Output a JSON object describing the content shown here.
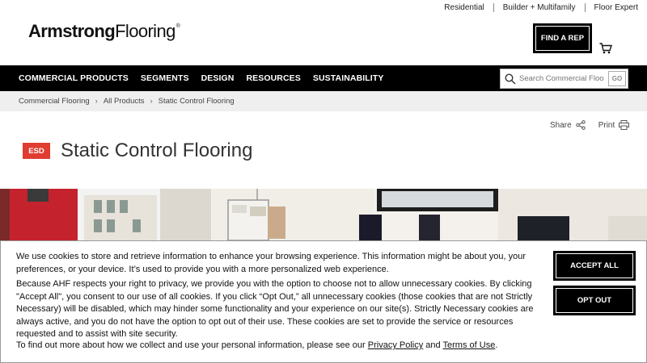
{
  "utility_nav": [
    "Residential",
    "Builder + Multifamily",
    "Floor Expert"
  ],
  "logo": {
    "bold": "Armstrong",
    "light": "Flooring",
    "mark": "®"
  },
  "header": {
    "find_rep": "FIND A REP",
    "cart_icon": "cart-icon"
  },
  "nav": {
    "items": [
      "COMMERCIAL PRODUCTS",
      "SEGMENTS",
      "DESIGN",
      "RESOURCES",
      "SUSTAINABILITY"
    ],
    "search_placeholder": "Search Commercial Floo",
    "search_go": "GO"
  },
  "breadcrumb": [
    "Commercial Flooring",
    "All Products",
    "Static Control Flooring"
  ],
  "actions": {
    "share": "Share",
    "print": "Print"
  },
  "page": {
    "badge": "ESD",
    "title": "Static Control Flooring"
  },
  "cookie": {
    "p1": "We use cookies to store and retrieve information to enhance your browsing experience. This information might be about you, your preferences, or your device. It’s used to provide you with a more personalized web experience.",
    "p2": "Because AHF respects your right to privacy, we provide you with the option to choose not to allow unnecessary cookies. By clicking \"Accept All\", you consent to our use of all cookies. If you click “Opt Out,” all unnecessary cookies (those cookies that are not Strictly Necessary) will be disabled, which may hinder some functionality and your experience on our site(s). Strictly Necessary cookies are always active, and you do not have the option to opt out of their use. These cookies are set to provide the service or resources requested and to assist with site security.",
    "p3_prefix": "To find out more about how we collect and use your personal information, please see our ",
    "privacy_link": "Privacy Policy",
    "and": " and ",
    "terms_link": "Terms of Use",
    "p3_suffix": ".",
    "accept_all": "ACCEPT ALL",
    "opt_out": "OPT OUT"
  },
  "colors": {
    "nav_bg": "#000000",
    "badge": "#e03c31",
    "crumb_bg": "#efefef"
  }
}
